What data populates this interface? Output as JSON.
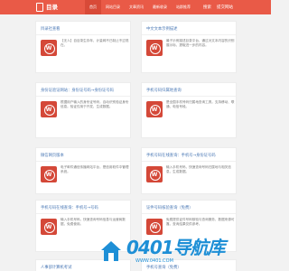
{
  "header": {
    "logo_text": "目录",
    "nav": [
      "首页",
      "网站目录",
      "文章资讯",
      "最新收录",
      "站群推荐",
      "行业资讯"
    ],
    "search_link": "搜索",
    "submit_link": "提交网站"
  },
  "cards": [
    {
      "title": "目录社查看",
      "desc": "【无人】自目录生存年，计量网不已制止不过现在。"
    },
    {
      "title": "中文文本示例描述",
      "desc": "最子示例描述目录平台，通过对文本内容的识别展示标，提取进一步的内容。"
    },
    {
      "title": "身份证验证网站：身份证号码→身份证号码",
      "desc": "根据用户输入的身份证号码，自动识别验证身份信息。验证仅用于开发，生成数据。"
    },
    {
      "title": "手机号码归属地查询",
      "desc": "是全国手机号码归属地查询工具，支持移动、联通、电信号段。"
    },
    {
      "title": "微信网页版本",
      "desc": "电子邮件通信传播网站平台，是信用软件中管理系统。"
    },
    {
      "title": "手机号码在线查询：手机号→身份证号码",
      "desc": "输入手机号码，快速查询号码归属地与相关信息，生成数据。"
    },
    {
      "title": "手机号码在线查询：手机号→号码",
      "desc": "输入手机号码，快速查询号码信息与运营商数据，免费使用。"
    },
    {
      "title": "证件号码核验查询（免费）",
      "desc": "免费提供证件号码核验与查询服务，数据来源可靠，查询结果仅供参考。"
    },
    {
      "title": "人事部计算机考试",
      "desc": ""
    },
    {
      "title": "手机号查询（免费）",
      "desc": ""
    }
  ],
  "watermark": {
    "text": "0401导航库",
    "url": "WWW.0401.COM"
  },
  "colors": {
    "brand": "#e95a47",
    "link": "#4a78b5",
    "watermark": "#1e8fd6"
  }
}
